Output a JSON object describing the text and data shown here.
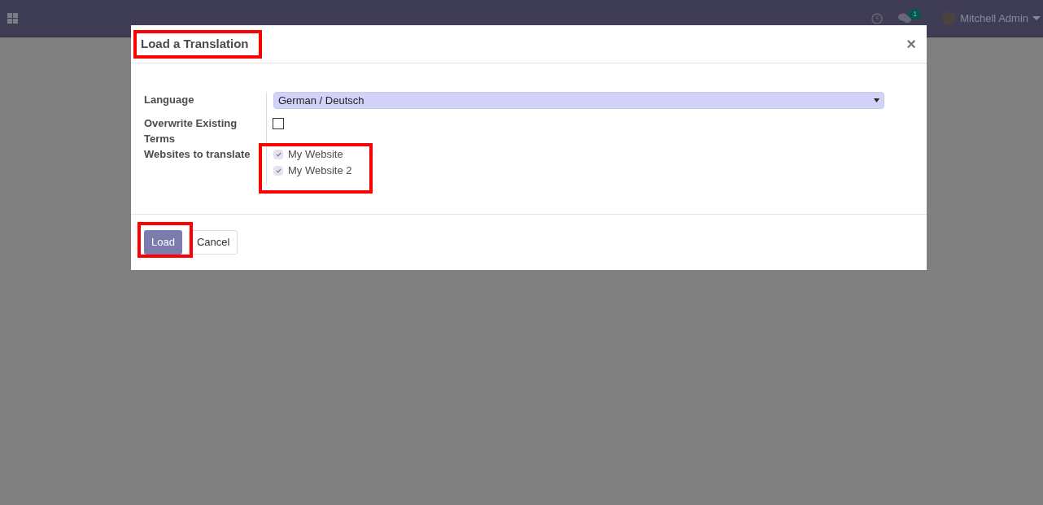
{
  "navbar": {
    "messages_badge": "1",
    "user_name": "Mitchell Admin"
  },
  "dialog": {
    "title": "Load a Translation",
    "close": "×",
    "language": {
      "label": "Language",
      "value": "German / Deutsch"
    },
    "overwrite": {
      "label": "Overwrite Existing Terms",
      "checked": false
    },
    "websites": {
      "label": "Websites to translate",
      "items": [
        {
          "name": "My Website",
          "checked": true
        },
        {
          "name": "My Website 2",
          "checked": true
        }
      ]
    },
    "buttons": [
      {
        "label": "Load",
        "kind": "primary"
      },
      {
        "label": "Cancel",
        "kind": "secondary"
      }
    ]
  }
}
